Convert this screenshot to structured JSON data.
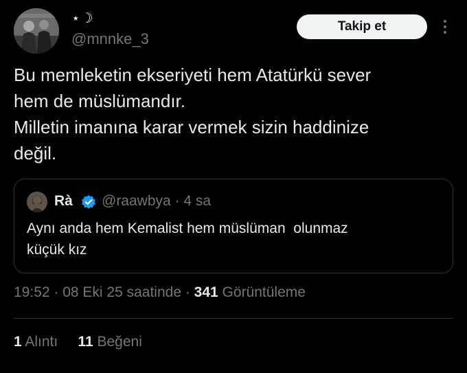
{
  "author": {
    "display_name": "⋆☽",
    "handle": "@mnnke_3",
    "avatar_icon": "avatar-photo"
  },
  "follow_label": "Takip et",
  "more_icon": "more-vertical-icon",
  "tweet": {
    "lines": [
      "Bu memleketin ekseriyeti hem Atatürkü sever",
      "hem de müslümandır.",
      "Milletin imanına karar vermek sizin haddinize",
      "değil."
    ]
  },
  "quote": {
    "name": "Rà",
    "handle_time": "@raawbya · 4 sa",
    "lines": [
      "Aynı anda hem Kemalist hem müslüman  olunmaz",
      "küçük kız"
    ],
    "verified_color": "#1d9bf0"
  },
  "meta": {
    "time_date": "19:52 · 08 Eki 25 saatinde · ",
    "views_count": "341",
    "views_label": " Görüntüleme"
  },
  "stats": {
    "quotes_count": "1",
    "quotes_label": "Alıntı",
    "likes_count": "11",
    "likes_label": "Beğeni"
  },
  "colors": {
    "background": "#000000",
    "text_primary": "#e7e9ea",
    "text_secondary": "#71767b",
    "border": "#2f3336",
    "button_bg": "#eff3f4"
  }
}
